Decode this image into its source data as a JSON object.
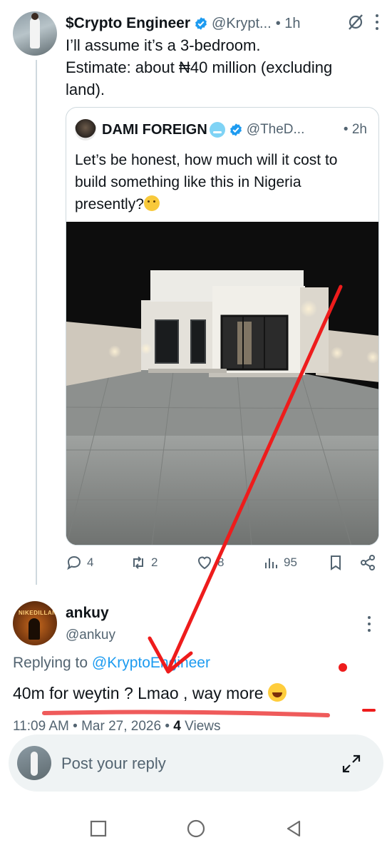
{
  "tweet": {
    "author_name": "$Crypto Engineer",
    "handle": "@Krypt...",
    "time": "• 1h",
    "text": "I’ll assume it’s a 3-bedroom.\nEstimate: about ₦40 million (excluding land)."
  },
  "quote": {
    "author_name": "DAMI FOREIGN",
    "handle": "@TheD...",
    "time": "• 2h",
    "text": "Let’s be honest, how much will it cost to build something like this in Nigeria presently?"
  },
  "actions": {
    "replies": "4",
    "reposts": "2",
    "likes": "8",
    "views": "95"
  },
  "reply": {
    "author_name": "ankuy",
    "handle": "@ankuy",
    "replying_prefix": "Replying to ",
    "replying_to": "@KryptoEngineer",
    "text": "40m for weytin ? Lmao , way more ",
    "time": "11:09 AM",
    "date": "Mar 27, 2026",
    "views": "4",
    "views_label": "Views",
    "avatar_text": "NIKEDILLAN"
  },
  "composer": {
    "placeholder": "Post your reply"
  },
  "colors": {
    "accent": "#1d9bf0",
    "annotation": "#ee1c1c",
    "muted": "#536471"
  }
}
